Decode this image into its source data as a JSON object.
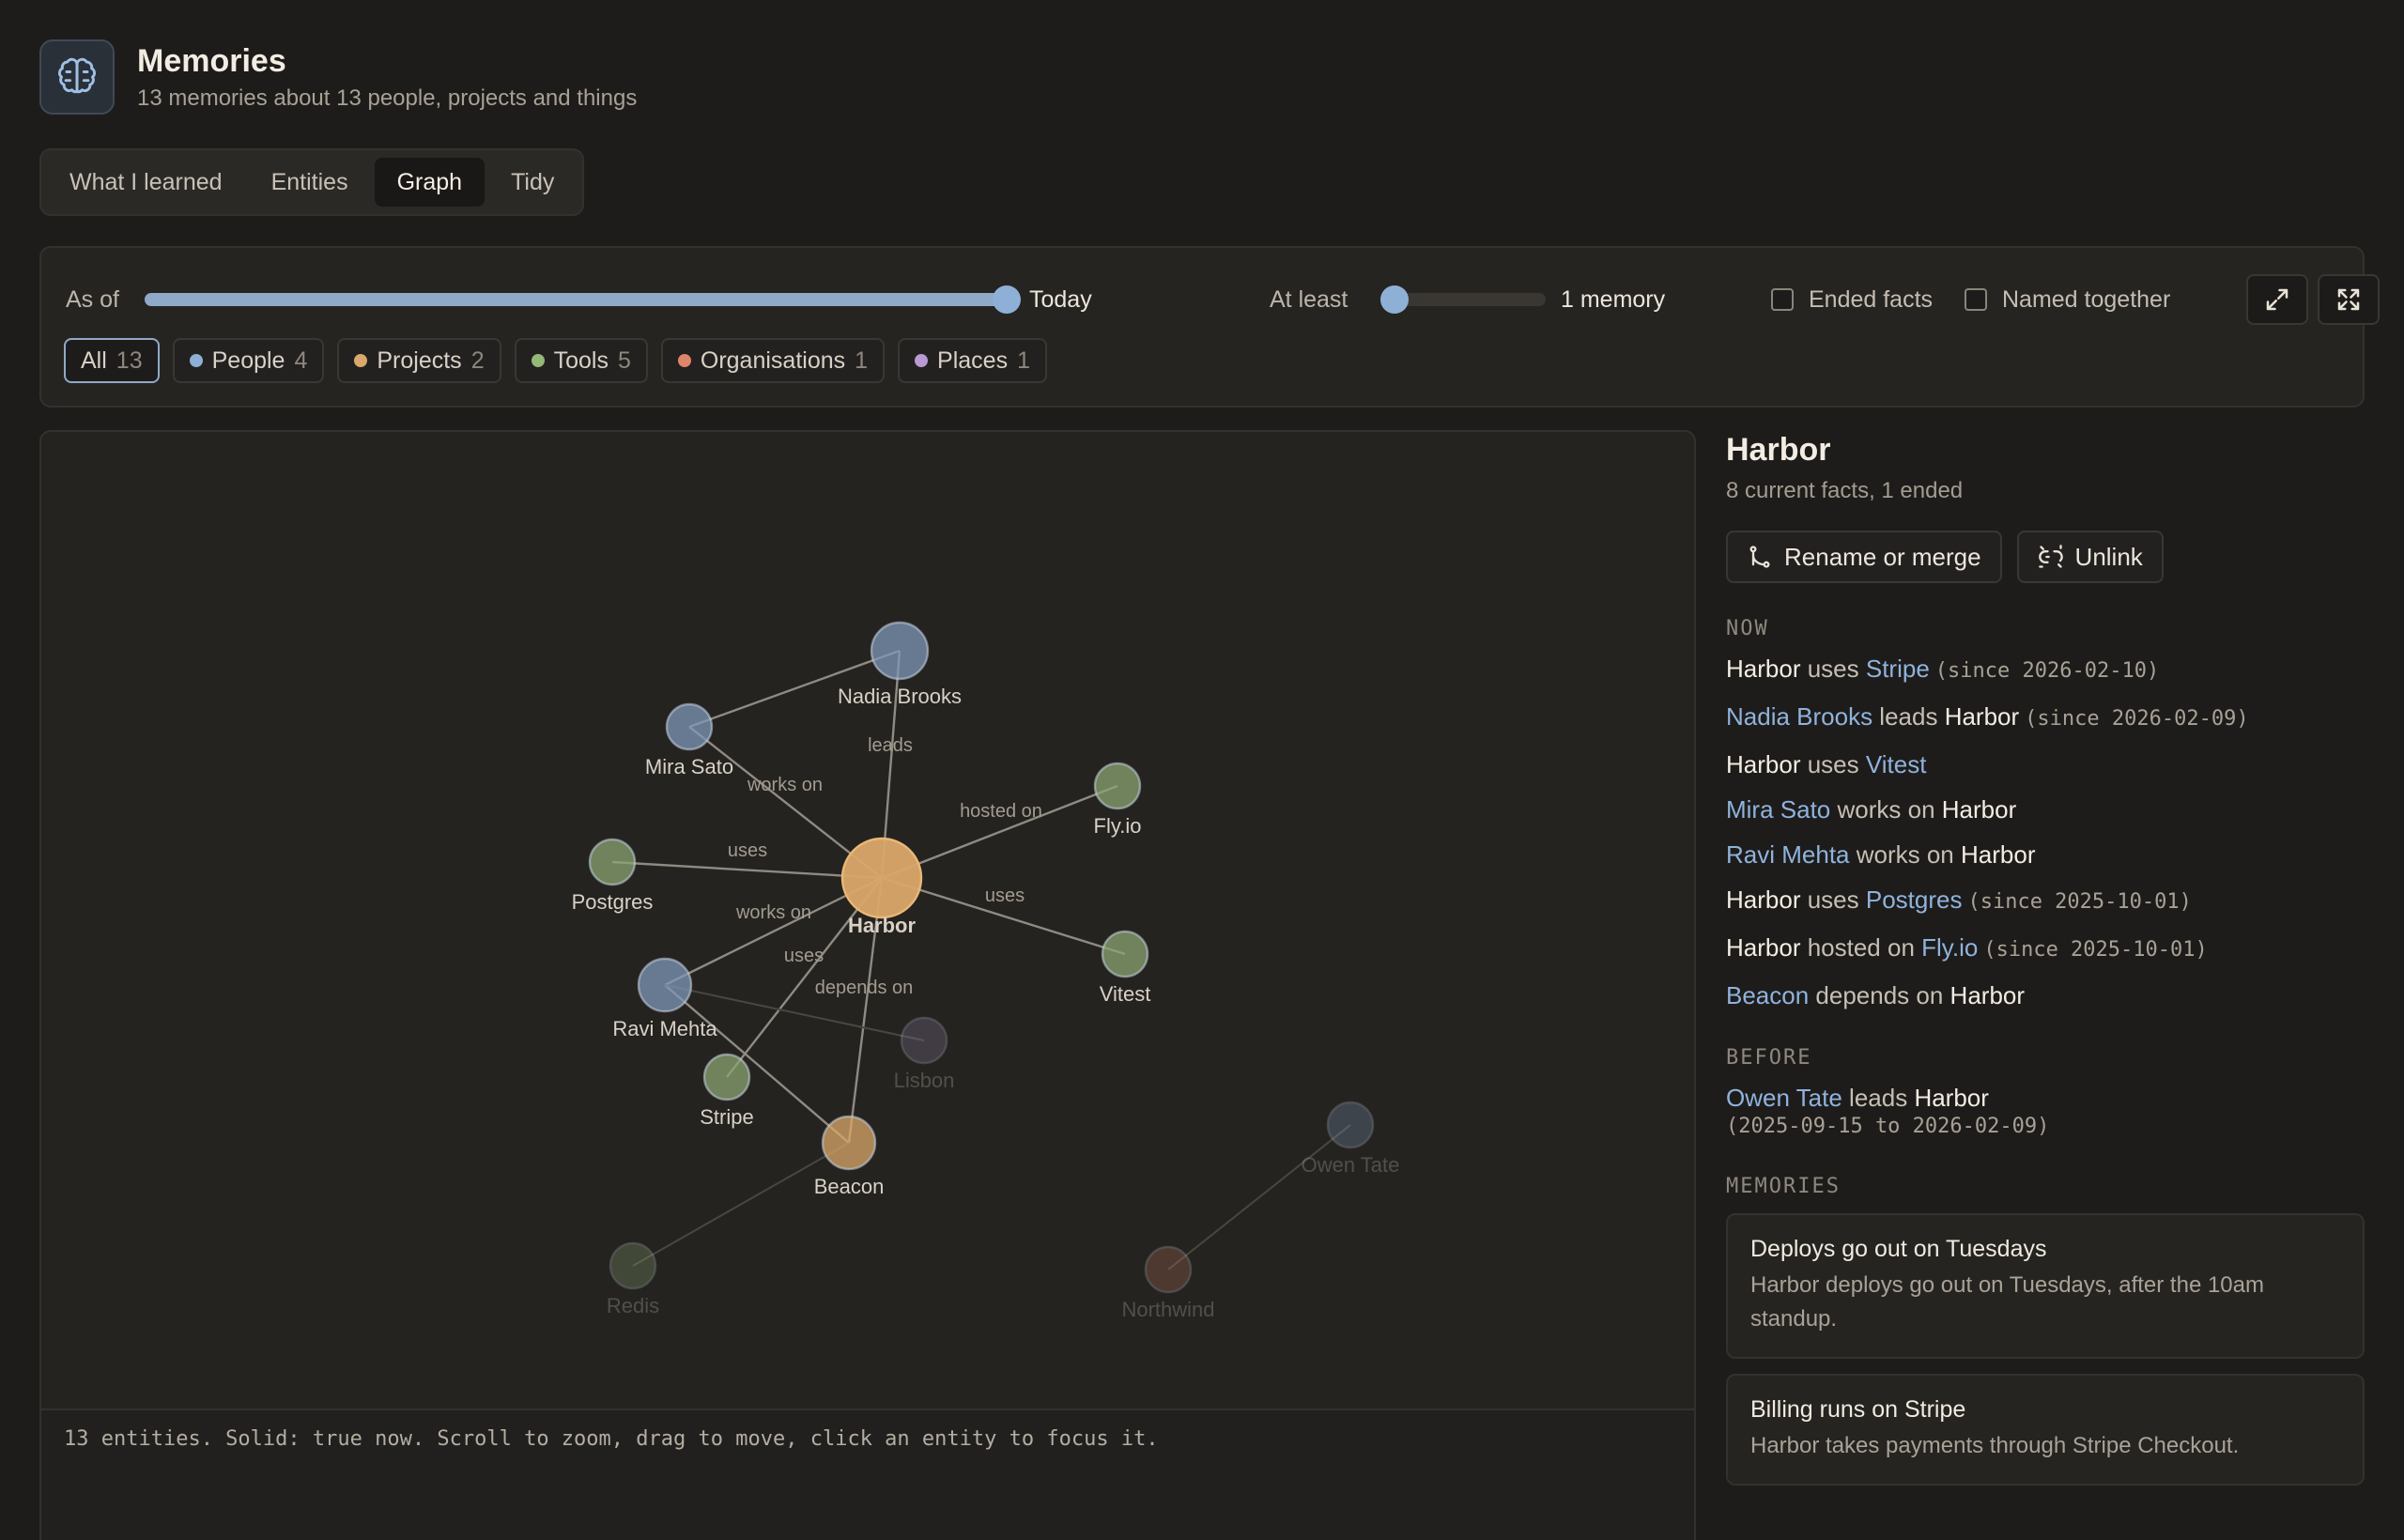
{
  "header": {
    "title": "Memories",
    "subtitle": "13 memories about 13 people, projects and things"
  },
  "tabs": [
    {
      "label": "What I learned",
      "active": false
    },
    {
      "label": "Entities",
      "active": false
    },
    {
      "label": "Graph",
      "active": true
    },
    {
      "label": "Tidy",
      "active": false
    }
  ],
  "filters": {
    "as_of_label": "As of",
    "as_of_value": "Today",
    "as_of_fraction": 1.0,
    "at_least_label": "At least",
    "at_least_value": "1 memory",
    "at_least_fraction": 0.0,
    "ended_facts_label": "Ended facts",
    "ended_facts_checked": false,
    "named_together_label": "Named together",
    "named_together_checked": false,
    "chips": [
      {
        "label": "All",
        "count": "13",
        "color": "",
        "active": true
      },
      {
        "label": "People",
        "count": "4",
        "color": "#8fb0d6",
        "active": false
      },
      {
        "label": "Projects",
        "count": "2",
        "color": "#d9a86a",
        "active": false
      },
      {
        "label": "Tools",
        "count": "5",
        "color": "#93b877",
        "active": false
      },
      {
        "label": "Organisations",
        "count": "1",
        "color": "#e0856a",
        "active": false
      },
      {
        "label": "Places",
        "count": "1",
        "color": "#b89ad4",
        "active": false
      }
    ]
  },
  "graph": {
    "footer": "13 entities. Solid: true now. Scroll to zoom, drag to move, click an entity to focus it.",
    "colors": {
      "person": "#7f97b8",
      "project": "#d9a86a",
      "tool": "#8aa470",
      "org": "#b2705a",
      "place": "#8a7aa0"
    },
    "nodes": [
      {
        "name": "Harbor",
        "type": "project",
        "faded": false,
        "focused": true
      },
      {
        "name": "Nadia Brooks",
        "type": "person",
        "faded": false
      },
      {
        "name": "Mira Sato",
        "type": "person",
        "faded": false
      },
      {
        "name": "Postgres",
        "type": "tool",
        "faded": false
      },
      {
        "name": "Fly.io",
        "type": "tool",
        "faded": false
      },
      {
        "name": "Vitest",
        "type": "tool",
        "faded": false
      },
      {
        "name": "Ravi Mehta",
        "type": "person",
        "faded": false
      },
      {
        "name": "Stripe",
        "type": "tool",
        "faded": false
      },
      {
        "name": "Beacon",
        "type": "project",
        "faded": false
      },
      {
        "name": "Lisbon",
        "type": "place",
        "faded": true
      },
      {
        "name": "Owen Tate",
        "type": "person",
        "faded": true
      },
      {
        "name": "Redis",
        "type": "tool",
        "faded": true
      },
      {
        "name": "Northwind",
        "type": "org",
        "faded": true
      }
    ],
    "edges": [
      {
        "from": "Nadia Brooks",
        "to": "Harbor",
        "label": "leads"
      },
      {
        "from": "Mira Sato",
        "to": "Harbor",
        "label": "works on"
      },
      {
        "from": "Mira Sato",
        "to": "Nadia Brooks",
        "label": ""
      },
      {
        "from": "Harbor",
        "to": "Postgres",
        "label": "uses"
      },
      {
        "from": "Harbor",
        "to": "Fly.io",
        "label": "hosted on"
      },
      {
        "from": "Harbor",
        "to": "Vitest",
        "label": "uses"
      },
      {
        "from": "Ravi Mehta",
        "to": "Harbor",
        "label": "works on"
      },
      {
        "from": "Harbor",
        "to": "Stripe",
        "label": "uses"
      },
      {
        "from": "Beacon",
        "to": "Harbor",
        "label": "depends on"
      },
      {
        "from": "Ravi Mehta",
        "to": "Beacon",
        "label": ""
      },
      {
        "from": "Ravi Mehta",
        "to": "Lisbon",
        "label": "",
        "faded": true
      },
      {
        "from": "Beacon",
        "to": "Redis",
        "label": "",
        "faded": true
      },
      {
        "from": "Owen Tate",
        "to": "Northwind",
        "label": "",
        "faded": true
      }
    ]
  },
  "detail": {
    "title": "Harbor",
    "subtitle": "8 current facts, 1 ended",
    "rename_label": "Rename or merge",
    "unlink_label": "Unlink",
    "now_heading": "NOW",
    "now_facts": [
      {
        "a": "Harbor",
        "a_link": false,
        "rel": "uses",
        "b": "Stripe",
        "b_link": true,
        "since": "(since 2026-02-10)"
      },
      {
        "a": "Nadia Brooks",
        "a_link": true,
        "rel": "leads",
        "b": "Harbor",
        "b_link": false,
        "since": "(since 2026-02-09)"
      },
      {
        "a": "Harbor",
        "a_link": false,
        "rel": "uses",
        "b": "Vitest",
        "b_link": true,
        "since": ""
      },
      {
        "a": "Mira Sato",
        "a_link": true,
        "rel": "works on",
        "b": "Harbor",
        "b_link": false,
        "since": ""
      },
      {
        "a": "Ravi Mehta",
        "a_link": true,
        "rel": "works on",
        "b": "Harbor",
        "b_link": false,
        "since": ""
      },
      {
        "a": "Harbor",
        "a_link": false,
        "rel": "uses",
        "b": "Postgres",
        "b_link": true,
        "since": "(since 2025-10-01)"
      },
      {
        "a": "Harbor",
        "a_link": false,
        "rel": "hosted on",
        "b": "Fly.io",
        "b_link": true,
        "since": "(since 2025-10-01)"
      },
      {
        "a": "Beacon",
        "a_link": true,
        "rel": "depends on",
        "b": "Harbor",
        "b_link": false,
        "since": ""
      }
    ],
    "before_heading": "BEFORE",
    "before_facts": [
      {
        "a": "Owen Tate",
        "a_link": true,
        "rel": "leads",
        "b": "Harbor",
        "b_link": false,
        "range": "(2025-09-15 to 2026-02-09)"
      }
    ],
    "memories_heading": "MEMORIES",
    "memories": [
      {
        "title": "Deploys go out on Tuesdays",
        "body": "Harbor deploys go out on Tuesdays, after the 10am standup."
      },
      {
        "title": "Billing runs on Stripe",
        "body": "Harbor takes payments through Stripe Checkout."
      }
    ]
  }
}
